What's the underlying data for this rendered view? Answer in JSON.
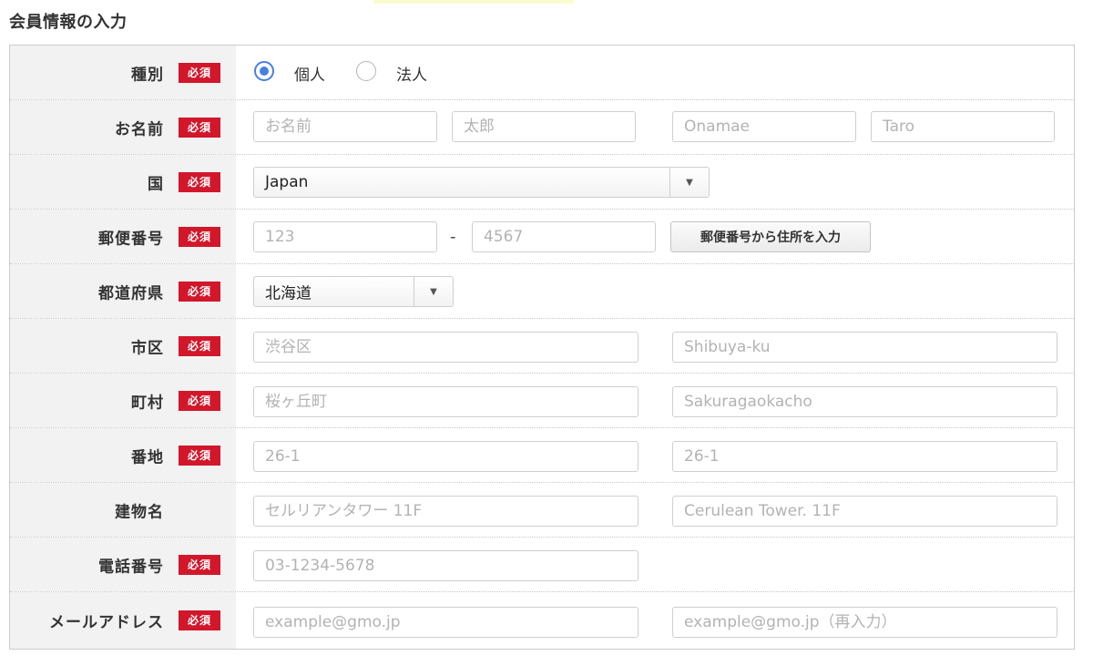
{
  "section_title": "会員情報の入力",
  "required_badge": "必須",
  "rows": {
    "type": {
      "label": "種別",
      "options": [
        "個人",
        "法人"
      ],
      "selected": "個人"
    },
    "name": {
      "label": "お名前",
      "placeholders": [
        "お名前",
        "太郎",
        "Onamae",
        "Taro"
      ]
    },
    "country": {
      "label": "国",
      "value": "Japan"
    },
    "postal": {
      "label": "郵便番号",
      "placeholders": [
        "123",
        "4567"
      ],
      "separator": "-",
      "button_label": "郵便番号から住所を入力"
    },
    "prefecture": {
      "label": "都道府県",
      "value": "北海道"
    },
    "city": {
      "label": "市区",
      "placeholders": [
        "渋谷区",
        "Shibuya-ku"
      ]
    },
    "town": {
      "label": "町村",
      "placeholders": [
        "桜ヶ丘町",
        "Sakuragaokacho"
      ]
    },
    "block": {
      "label": "番地",
      "placeholders": [
        "26-1",
        "26-1"
      ]
    },
    "building": {
      "label": "建物名",
      "placeholders": [
        "セルリアンタワー 11F",
        "Cerulean Tower. 11F"
      ]
    },
    "phone": {
      "label": "電話番号",
      "placeholders": [
        "03-1234-5678"
      ]
    },
    "email": {
      "label": "メールアドレス",
      "placeholders": [
        "example@gmo.jp",
        "example@gmo.jp（再入力）"
      ]
    }
  },
  "colors": {
    "required_badge": "#d2172b",
    "radio_accent": "#4a7fe0",
    "label_background": "#f2f2f2"
  }
}
